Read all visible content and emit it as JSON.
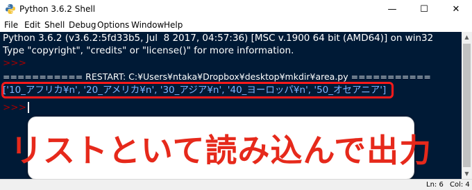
{
  "window": {
    "title": "Python 3.6.2 Shell",
    "minimize_glyph": "—",
    "maximize_glyph": "☐",
    "close_glyph": "✕"
  },
  "menu": [
    "File",
    "Edit",
    "Shell",
    "Debug",
    "Options",
    "Window",
    "Help"
  ],
  "shell": {
    "line1": "Python 3.6.2 (v3.6.2:5fd33b5, Jul  8 2017, 04:57:36) [MSC v.1900 64 bit (AMD64)] on win32",
    "line2": "Type \"copyright\", \"credits\" or \"license()\" for more information.",
    "prompt1": ">>>",
    "restart": "=========== RESTART: C:¥Users¥ntaka¥Dropbox¥desktop¥mkdir¥area.py ===========",
    "list_output": "['10_アフリカ¥n', '20_アメリカ¥n', '30_アジア¥n', '40_ヨーロッパ¥n', '50_オセアニア']",
    "prompt2": ">>>"
  },
  "callout": {
    "text": "リストといて読み込んで出力"
  },
  "status": {
    "ln": "Ln: 6",
    "col": "Col: 4"
  },
  "colors": {
    "shell_bg": "#001a36",
    "prompt": "#a60000",
    "list_output": "#7fb4ff",
    "highlight": "#ff1a1a",
    "callout_text": "#e6291b"
  }
}
